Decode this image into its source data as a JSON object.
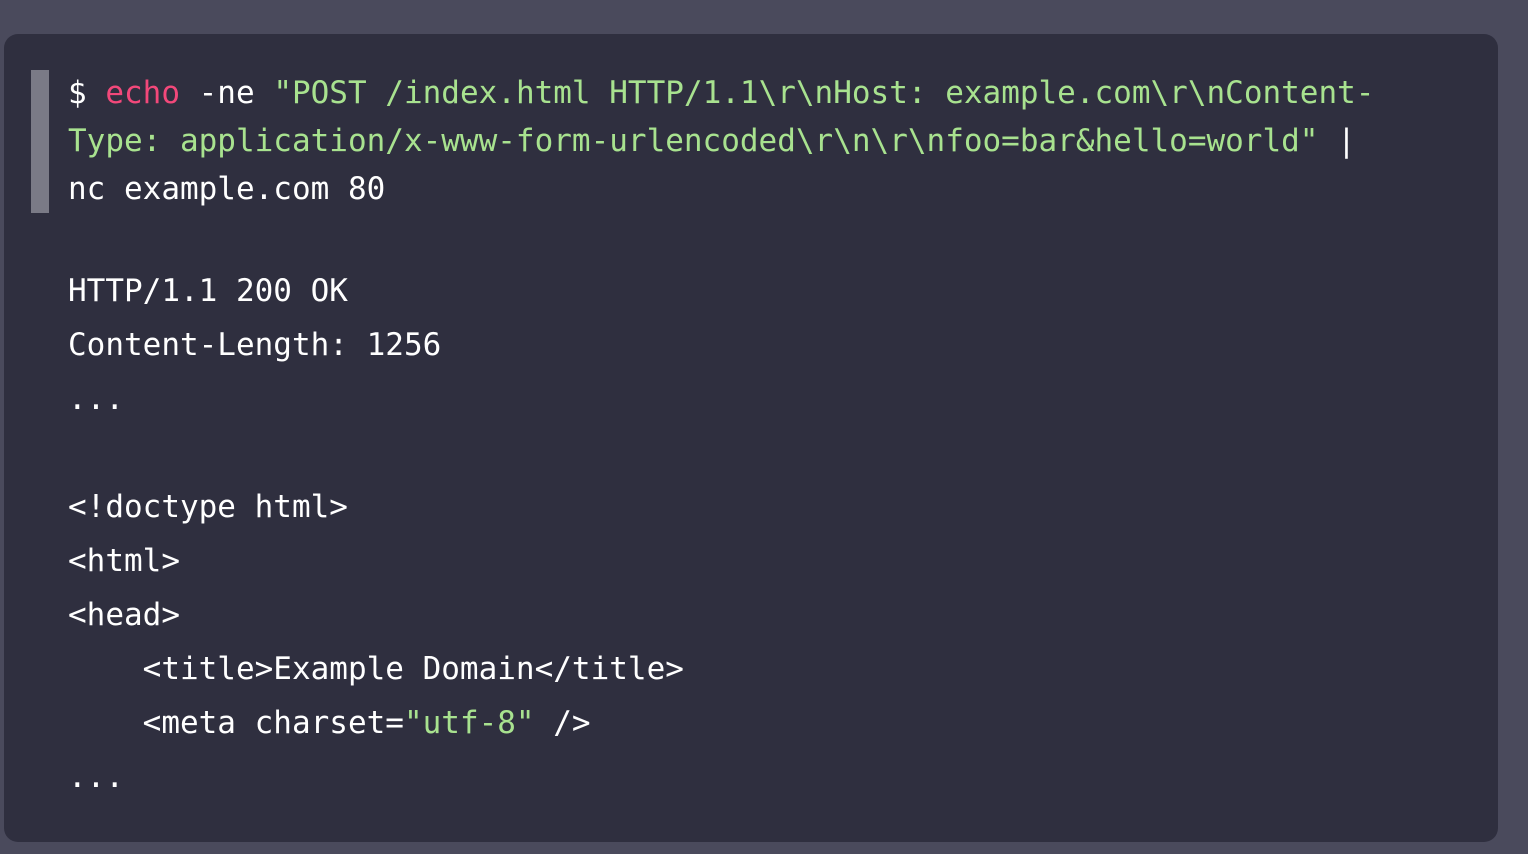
{
  "terminal": {
    "prompt": "$ ",
    "command_keyword": "echo",
    "command_flag": " -ne ",
    "command_string_line1": "\"POST /index.html HTTP/1.1\\r\\nHost: example.com\\r\\nContent-",
    "command_string_line2": "Type: application/x-www-form-urlencoded\\r\\n\\r\\nfoo=bar&hello=world\"",
    "pipe": " |",
    "command_line3": "nc example.com 80",
    "output": {
      "status_line": "HTTP/1.1 200 OK",
      "content_length": "Content-Length: 1256",
      "ellipsis1": "...",
      "doctype": "<!doctype html>",
      "html_open": "<html>",
      "head_open": "<head>",
      "title_line": "    <title>Example Domain</title>",
      "meta_prefix": "    <meta charset=",
      "meta_value": "\"utf-8\"",
      "meta_suffix": " />",
      "ellipsis2": "..."
    }
  },
  "colors": {
    "background": "#4a4a5c",
    "panel": "#2f2f3f",
    "keyword": "#f2487a",
    "string": "#a8e28f",
    "text": "#ffffff",
    "selection_bar": "#7a7a86"
  }
}
